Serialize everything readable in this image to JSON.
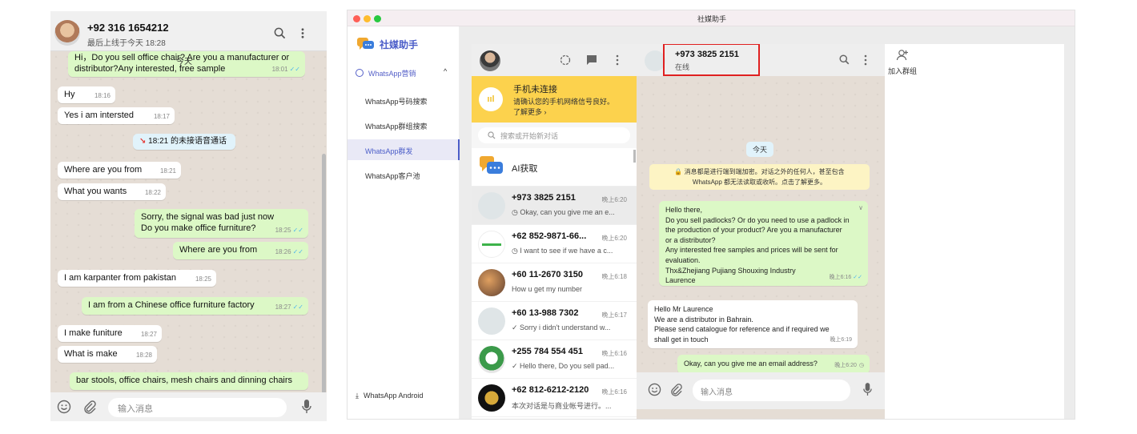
{
  "left": {
    "contact": "+92 316 1654212",
    "last_seen": "最后上线于今天 18:28",
    "input_placeholder": "输入消息",
    "overlay_label": "今天",
    "messages": [
      {
        "side": "out",
        "text": "Hi，Do you sell office chair? Are you a manufacturer or distributor?Any interested, free sample",
        "time": "18:01"
      },
      {
        "side": "in",
        "text": "Hy",
        "time": "18:16"
      },
      {
        "side": "in",
        "text": "Yes i am intersted",
        "time": "18:17"
      },
      {
        "side": "system",
        "text": "18:21 的未接语音通话"
      },
      {
        "side": "in",
        "text": "Where are you from",
        "time": "18:21"
      },
      {
        "side": "in",
        "text": "What you wants",
        "time": "18:22"
      },
      {
        "side": "out",
        "text": "Sorry, the signal was bad just now",
        "text2": "Do you make office furniture?",
        "time": "18:25"
      },
      {
        "side": "out",
        "text": "Where are you from",
        "time": "18:26"
      },
      {
        "side": "in",
        "text": "I am karpanter from pakistan",
        "time": "18:25"
      },
      {
        "side": "out",
        "text": "I am from a Chinese office furniture factory",
        "time": "18:27"
      },
      {
        "side": "in",
        "text": "I make funiture",
        "time": "18:27"
      },
      {
        "side": "in",
        "text": "What is make",
        "time": "18:28"
      },
      {
        "side": "out",
        "text": "bar stools, office chairs, mesh chairs and dinning chairs"
      }
    ]
  },
  "app": {
    "window_title": "社媒助手",
    "brand": "社媒助手",
    "group": "WhatsApp营销",
    "nav": [
      "WhatsApp号码搜索",
      "WhatsApp群组搜索",
      "WhatsApp群发",
      "WhatsApp客户池"
    ],
    "android_label": "WhatsApp Android",
    "warning_title": "手机未连接",
    "warning_text": "请确认您的手机网络信号良好。",
    "warning_link": "了解更多 ›",
    "search_placeholder": "搜索或开始新对话",
    "ai_label": "AI获取",
    "chats": [
      {
        "name": "+973 3825 2151",
        "time": "晚上6:20",
        "msg": "Okay, can you give me an e..."
      },
      {
        "name": "+62 852-9871-66...",
        "time": "晚上6:20",
        "msg": "I want to see if we have a c..."
      },
      {
        "name": "+60 11-2670 3150",
        "time": "晚上6:18",
        "msg": "How u get my number"
      },
      {
        "name": "+60 13-988 7302",
        "time": "晚上6:17",
        "msg": "Sorry i didn't understand w..."
      },
      {
        "name": "+255 784 554 451",
        "time": "晚上6:16",
        "msg": "Hello there, Do you sell pad..."
      },
      {
        "name": "+62 812-6212-2120",
        "time": "晚上6:16",
        "msg": "本次对话是与商业帐号进行。..."
      }
    ],
    "conversation": {
      "contact": "+973 3825 2151",
      "status": "在线",
      "date_label": "今天",
      "encryption_line1": "🔒 消息都是进行端到端加密。对话之外的任何人，甚至包含",
      "encryption_line2": "WhatsApp 都无法读取或收听。点击了解更多。",
      "input_placeholder": "输入消息",
      "messages": [
        {
          "side": "out",
          "lines": [
            "Hello there,",
            "Do you sell padlocks? Or do you need to use a padlock in",
            "the production of your product? Are you a manufacturer",
            "or a distributor?",
            "Any interested free samples and prices will be sent for",
            "evaluation.",
            "Thx&Zhejiang Pujiang Shouxing Industry",
            "Laurence"
          ],
          "time": "晚上6:16"
        },
        {
          "side": "in",
          "lines": [
            "Hello Mr Laurence",
            "We are a distributor in Bahrain.",
            "Please send catalogue for reference and if required we",
            "shall get in touch"
          ],
          "time": "晚上6:19"
        },
        {
          "side": "out",
          "lines": [
            "Okay, can you give me an email address?"
          ],
          "time": "晚上6:20"
        }
      ]
    },
    "join_group": "加入群组"
  },
  "colors": {
    "accent": "#4a5cc8",
    "warning": "#fcd24d",
    "outgoing": "#dcf8c6",
    "highlight": "#e02020"
  }
}
